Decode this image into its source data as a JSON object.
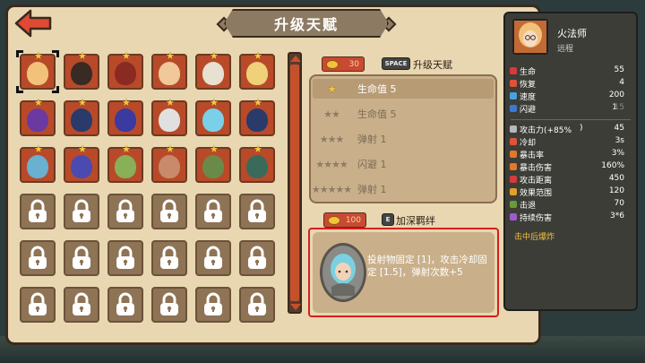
{
  "title": "升级天赋",
  "colors": {
    "accent": "#c94a32",
    "gold": "#f6c93c",
    "selection_border": "#d42020",
    "parchment": "#e9d7b1"
  },
  "roster": {
    "heroes": [
      {
        "name": "火法师",
        "color": "#f2c27a",
        "selected": true
      },
      {
        "name": "",
        "color": "#3a2a24"
      },
      {
        "name": "",
        "color": "#8a2a22"
      },
      {
        "name": "",
        "color": "#f0c89a"
      },
      {
        "name": "",
        "color": "#e8e0d0"
      },
      {
        "name": "",
        "color": "#f0d078"
      },
      {
        "name": "",
        "color": "#6a3aa0"
      },
      {
        "name": "",
        "color": "#2a3a6a"
      },
      {
        "name": "",
        "color": "#3a3aa0"
      },
      {
        "name": "",
        "color": "#e0e0e0"
      },
      {
        "name": "",
        "color": "#7ad0e8"
      },
      {
        "name": "",
        "color": "#2a3a6a"
      },
      {
        "name": "",
        "color": "#6ab0d0"
      },
      {
        "name": "",
        "color": "#4a4ab0"
      },
      {
        "name": "",
        "color": "#88b058"
      },
      {
        "name": "",
        "color": "#c88a6a"
      },
      {
        "name": "",
        "color": "#6a8a4a"
      },
      {
        "name": "",
        "color": "#3a6a5a"
      }
    ],
    "locked_count": 18,
    "columns": 6
  },
  "upgrade": {
    "cost": "30",
    "key": "SPACE",
    "label": "升级天赋"
  },
  "talents": [
    {
      "stars": "★",
      "text": "生命值 5",
      "active": true,
      "selected": true
    },
    {
      "stars": "★★",
      "text": "生命值 5",
      "active": false
    },
    {
      "stars": "★★★",
      "text": "弹射 1",
      "active": false
    },
    {
      "stars": "★★★★",
      "text": "闪避 1",
      "active": false
    },
    {
      "stars": "★★★★★",
      "text": "弹射 1",
      "active": false
    }
  ],
  "bond": {
    "cost": "100",
    "key": "E",
    "label": "加深羁绊",
    "description": "投射物固定 [1]，攻击冷却固定 [1.5]，弹射次数+5"
  },
  "hero": {
    "name": "火法师",
    "type": "远程",
    "stats_top": [
      {
        "label": "生命",
        "value": "55",
        "color": "#d63a3a"
      },
      {
        "label": "恢复",
        "value": "4",
        "color": "#e0523a"
      },
      {
        "label": "速度",
        "value": "200",
        "color": "#4aa0e0"
      },
      {
        "label": "闪避",
        "value": "1",
        "color": "#3a7ad0",
        "extra": "15"
      }
    ],
    "stats_bottom": [
      {
        "label": "攻击力(+85%",
        "value": "45",
        "color": "#b8b8b8",
        "suffix": ")"
      },
      {
        "label": "冷却",
        "value": "3s",
        "color": "#e0523a"
      },
      {
        "label": "暴击率",
        "value": "3%",
        "color": "#e07a2a"
      },
      {
        "label": "暴击伤害",
        "value": "160%",
        "color": "#e07a2a"
      },
      {
        "label": "攻击距离",
        "value": "450",
        "color": "#d63a3a"
      },
      {
        "label": "效果范围",
        "value": "120",
        "color": "#e0a02a"
      },
      {
        "label": "击退",
        "value": "70",
        "color": "#6a9a3a"
      },
      {
        "label": "持续伤害",
        "value": "3*6",
        "color": "#a05ad0"
      }
    ],
    "trait": "击中后爆炸"
  }
}
